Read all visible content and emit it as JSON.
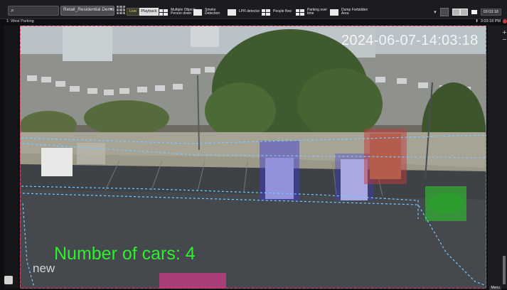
{
  "toolbar": {
    "search_placeholder": "",
    "site_select": "Retail_Residential Demo",
    "live_label": "Live",
    "playback_label": "Playback",
    "presets": [
      {
        "label": "Multiple Objects\nPerson down"
      },
      {
        "label": "Smoke\nDetection"
      },
      {
        "label": "LPR detector"
      },
      {
        "label": "People flow"
      },
      {
        "label": "Parking over\ntime"
      },
      {
        "label": "Dump Forbidden\nArea"
      }
    ],
    "clock": "03:03:18"
  },
  "tile": {
    "title": "1: West Parking",
    "time": "3:03:18 PM"
  },
  "video": {
    "timestamp": "2024-06-07-14:03:18",
    "car_count_text": "Number of cars: 4",
    "zone_label": "new"
  },
  "detections": [
    {
      "label": "car",
      "color": "#3b3bd6"
    },
    {
      "label": "car",
      "color": "#3b3bd6"
    },
    {
      "label": "car",
      "color": "#c23b3b"
    },
    {
      "label": "car",
      "color": "#2ec72e"
    },
    {
      "label": "car",
      "color": "#d63b8a"
    }
  ],
  "colors": {
    "accent_green": "#2ef12e",
    "zone_dashed": "#7fc8ff",
    "frame_border": "#e04a6a"
  },
  "right_panel": {
    "bottom_label": "Menu"
  }
}
